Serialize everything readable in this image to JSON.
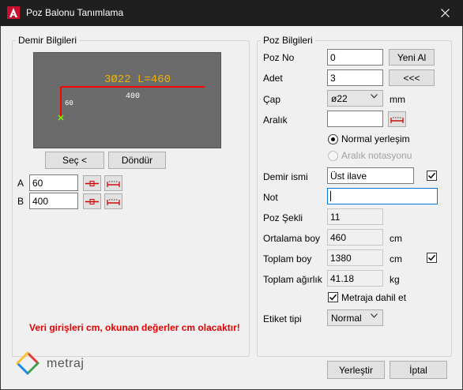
{
  "window": {
    "title": "Poz Balonu Tanımlama"
  },
  "demir": {
    "group_title": "Demir Bilgileri",
    "preview": {
      "rebar_text": "3Ø22 L=460",
      "length_label": "400",
      "hook_label": "60"
    },
    "sec_button": "Seç <",
    "dondur_button": "Döndür",
    "a_label": "A",
    "a_value": "60",
    "b_label": "B",
    "b_value": "400"
  },
  "poz": {
    "group_title": "Poz Bilgileri",
    "poz_no_label": "Poz No",
    "poz_no_value": "0",
    "yeni_al_button": "Yeni Al",
    "adet_label": "Adet",
    "adet_value": "3",
    "back_button": "<<<",
    "cap_label": "Çap",
    "cap_value": "ø22",
    "cap_unit": "mm",
    "aralik_label": "Aralık",
    "aralik_value": "",
    "normal_radio_label": "Normal yerleşim",
    "aralik_radio_label": "Aralık notasyonu",
    "demir_ismi_label": "Demir ismi",
    "demir_ismi_value": "Üst ilave",
    "demir_ismi_checked": true,
    "not_label": "Not",
    "not_value": "",
    "poz_sekli_label": "Poz Şekli",
    "poz_sekli_value": "11",
    "ortalama_boy_label": "Ortalama boy",
    "ortalama_boy_value": "460",
    "ortalama_boy_unit": "cm",
    "toplam_boy_label": "Toplam boy",
    "toplam_boy_value": "1380",
    "toplam_boy_unit": "cm",
    "toplam_boy_checked": true,
    "toplam_agirlik_label": "Toplam ağırlık",
    "toplam_agirlik_value": "41.18",
    "toplam_agirlik_unit": "kg",
    "metraja_label": "Metraja dahil et",
    "metraja_checked": true,
    "etiket_label": "Etiket tipi",
    "etiket_value": "Normal"
  },
  "warning_text": "Veri girişleri cm, okunan değerler cm olacaktır!",
  "logo_text": "metraj",
  "footer": {
    "yerlestir_button": "Yerleştir",
    "iptal_button": "İptal"
  },
  "colors": {
    "accent_red": "#e00000",
    "titlebar": "#1f1f1f",
    "rebar_red": "#ff0000",
    "rebar_text": "#f0b000",
    "focus_blue": "#0078d7"
  }
}
